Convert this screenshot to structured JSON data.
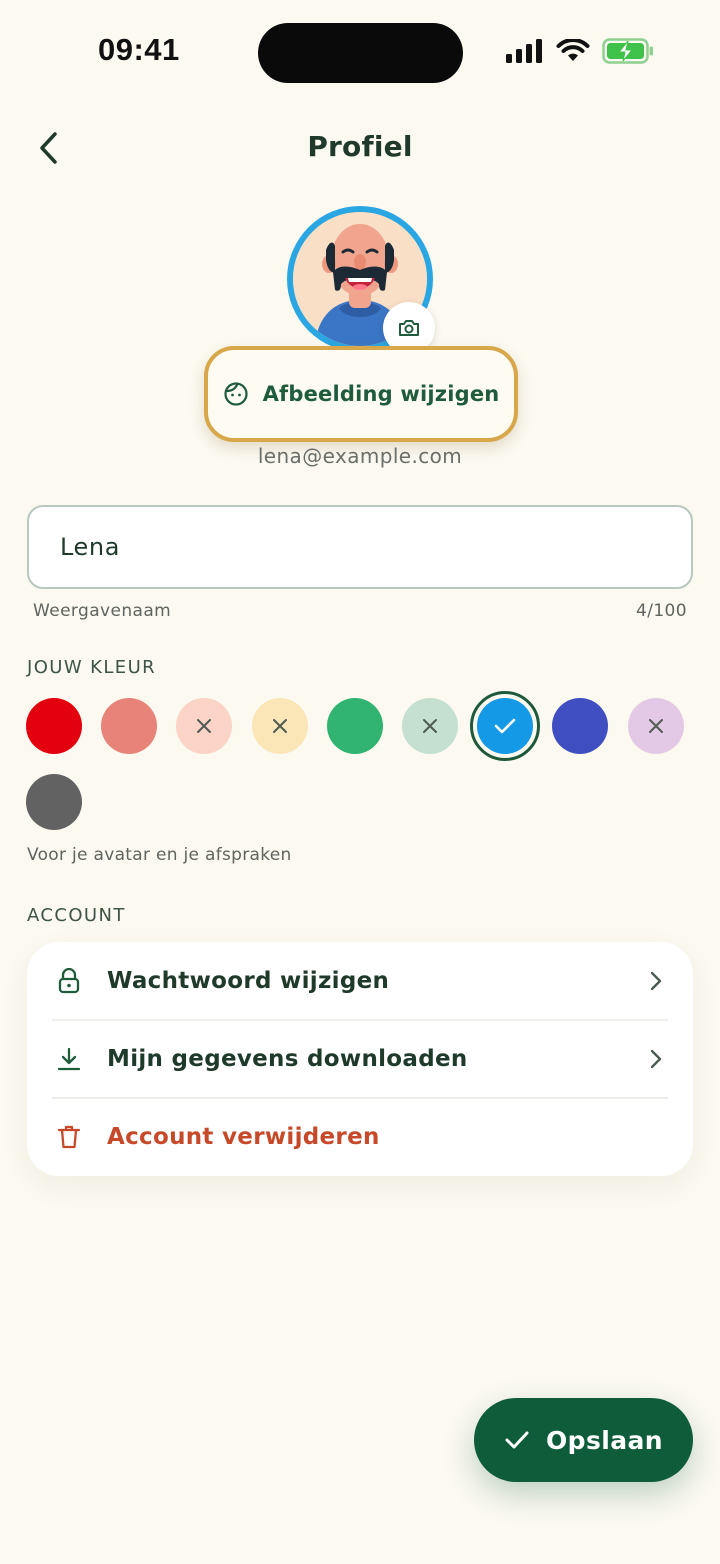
{
  "status_bar": {
    "time": "09:41"
  },
  "header": {
    "title": "Profiel",
    "back_icon": "chevron-left-icon"
  },
  "profile": {
    "change_picture_label": "Afbeelding wijzigen",
    "email": "lena@example.com"
  },
  "display_name": {
    "value": "Lena",
    "helper": "Weergavenaam",
    "counter": "4/100"
  },
  "color_section": {
    "title": "JOUW KLEUR",
    "hint": "Voor je avatar en je afspraken",
    "swatches": [
      {
        "color": "#e3000f",
        "state": "available"
      },
      {
        "color": "#e8837a",
        "state": "available"
      },
      {
        "color": "#fbd3c7",
        "state": "unavailable"
      },
      {
        "color": "#fbe6b8",
        "state": "unavailable"
      },
      {
        "color": "#31b472",
        "state": "available"
      },
      {
        "color": "#c5dfd0",
        "state": "unavailable"
      },
      {
        "color": "#1499e6",
        "state": "selected"
      },
      {
        "color": "#3f4fc1",
        "state": "available"
      },
      {
        "color": "#e3c9e6",
        "state": "unavailable"
      },
      {
        "color": "#626262",
        "state": "available"
      }
    ]
  },
  "account_section": {
    "title": "ACCOUNT",
    "items": [
      {
        "label": "Wachtwoord wijzigen",
        "icon": "lock-icon"
      },
      {
        "label": "Mijn gegevens downloaden",
        "icon": "download-icon"
      },
      {
        "label": "Account verwijderen",
        "icon": "trash-icon",
        "danger_color": "#c64a2a"
      }
    ]
  },
  "save": {
    "label": "Opslaan"
  },
  "colors": {
    "primary": "#0f5c3a",
    "highlight": "#d7a749",
    "background": "#fbf9f0"
  }
}
